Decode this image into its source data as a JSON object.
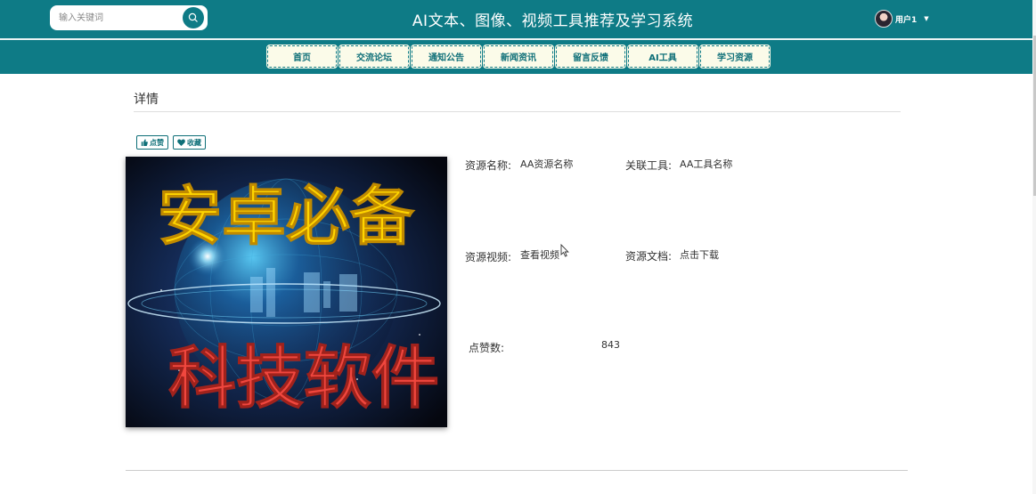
{
  "header": {
    "search_placeholder": "输入关键词",
    "title": "AI文本、图像、视频工具推荐及学习系统",
    "user_name": "用户1",
    "brand_color": "#0e7b86"
  },
  "nav": {
    "items": [
      "首页",
      "交流论坛",
      "通知公告",
      "新闻资讯",
      "留言反馈",
      "AI工具",
      "学习资源"
    ]
  },
  "detail": {
    "heading": "详情",
    "like_label": "点赞",
    "favorite_label": "收藏",
    "cover": {
      "line1": "安卓必备",
      "line2": "科技软件"
    },
    "fields": {
      "resource_name_label": "资源名称:",
      "resource_name_value": "AA资源名称",
      "related_tool_label": "关联工具:",
      "related_tool_value": "AA工具名称",
      "video_label": "资源视频:",
      "video_value": "查看视频",
      "doc_label": "资源文档:",
      "doc_value": "点击下载",
      "likes_label": "点赞数:",
      "likes_value": "843"
    }
  }
}
